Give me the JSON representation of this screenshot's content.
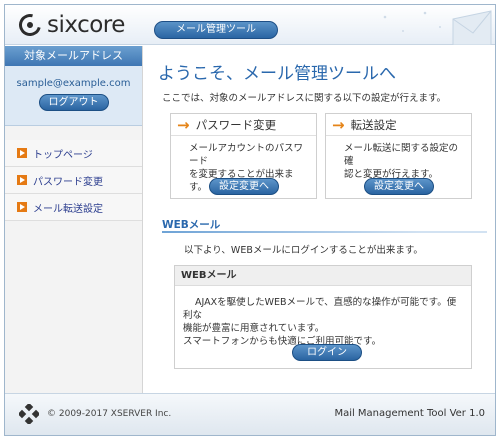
{
  "header": {
    "logo_text": "sixcore",
    "section_label": "メール管理ツール"
  },
  "sidebar": {
    "title": "対象メールアドレス",
    "email": "sample@example.com",
    "logout_label": "ログアウト",
    "items": [
      {
        "label": "トップページ"
      },
      {
        "label": "パスワード変更"
      },
      {
        "label": "メール転送設定"
      }
    ]
  },
  "main": {
    "welcome": "ようこそ、メール管理ツールへ",
    "intro": "ここでは、対象のメールアドレスに関する以下の設定が行えます。",
    "cards": [
      {
        "title": "パスワード変更",
        "desc_1": "メールアカウントのパスワード",
        "desc_2": "を変更することが出来ます。",
        "button": "設定変更へ"
      },
      {
        "title": "転送設定",
        "desc_1": "メール転送に関する設定の確",
        "desc_2": "認と変更が行えます。",
        "button": "設定変更へ"
      }
    ],
    "webmail": {
      "section_title": "WEBメール",
      "section_intro": "以下より、WEBメールにログインすることが出来ます。",
      "box_title": "WEBメール",
      "line_1": "AJAXを駆使したWEBメールで、直感的な操作が可能です。便利な",
      "line_2": "機能が豊富に用意されています。",
      "line_3": "スマートフォンからも快適にご利用可能です。",
      "login_label": "ログイン"
    }
  },
  "footer": {
    "copyright": "© 2009-2017 XSERVER Inc.",
    "version": "Mail Management Tool Ver 1.0"
  },
  "colors": {
    "accent_blue": "#2a68ad",
    "nav_arrow": "#e57a14"
  }
}
